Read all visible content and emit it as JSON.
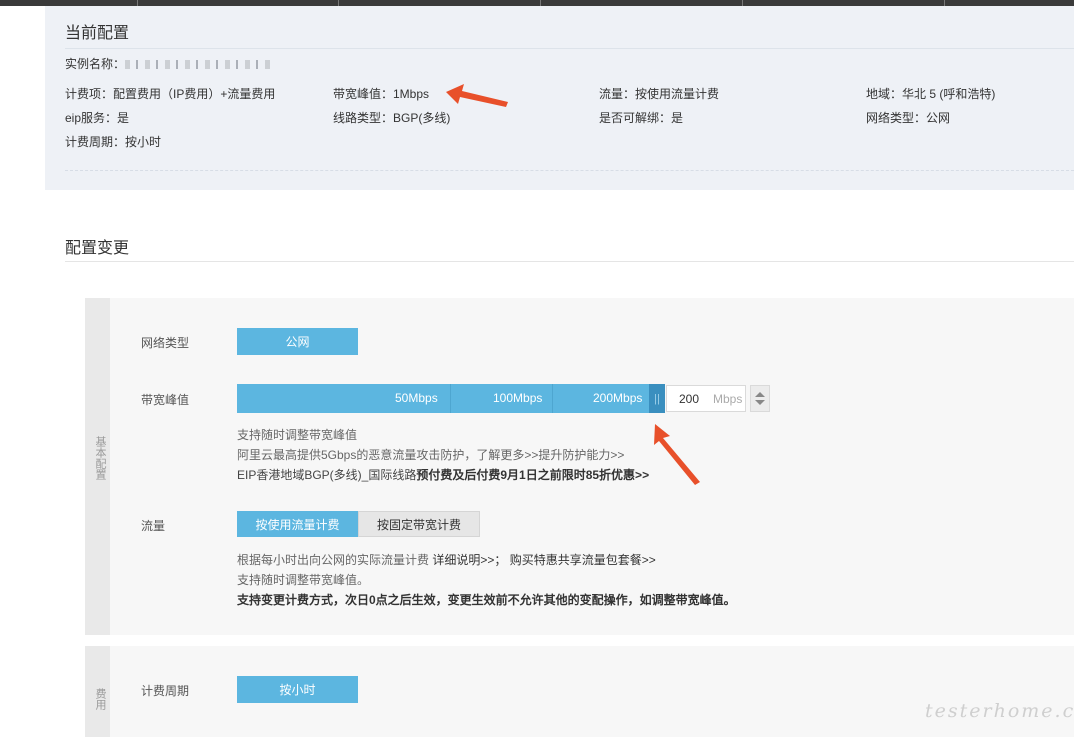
{
  "current_config": {
    "title": "当前配置",
    "instance_label": "实例名称：",
    "billing_item": "计费项：配置费用（IP费用）+流量费用",
    "bandwidth_peak": "带宽峰值：1Mbps",
    "traffic": "流量：按使用流量计费",
    "region": "地域：华北 5 (呼和浩特)",
    "eip_service": "eip服务：是",
    "line_type": "线路类型：BGP(多线)",
    "unbindable": "是否可解绑：是",
    "network_type": "网络类型：公网",
    "billing_cycle": "计费周期：按小时"
  },
  "change": {
    "title": "配置变更"
  },
  "basic_panel": {
    "side_label": "基本配置",
    "network_label": "网络类型",
    "network_value": "公网",
    "bandwidth_label": "带宽峰值",
    "slider_marks": [
      "50Mbps",
      "100Mbps",
      "200Mbps"
    ],
    "slider_value": 200,
    "slider_max": 200,
    "bandwidth_value": "200",
    "bandwidth_unit": "Mbps",
    "note1": "支持随时调整带宽峰值",
    "note2a": "阿里云最高提供5Gbps的恶意流量攻击防护，",
    "note2b": "了解更多>>提升防护能力>>",
    "note3a": "EIP香港地域BGP(多线)_国际线路",
    "note3b": "预付费及后付费9月1日之前限时85折优惠>>",
    "traffic_label": "流量",
    "traffic_btn_usage": "按使用流量计费",
    "traffic_btn_fixed": "按固定带宽计费",
    "traffic_note1a": "根据每小时出向公网的实际流量计费",
    "traffic_note1b": "详细说明>>；  购买特惠共享流量包套餐>>",
    "traffic_note2": "支持随时调整带宽峰值。",
    "traffic_note3": "支持变更计费方式，次日0点之后生效，变更生效前不允许其他的变配操作，如调整带宽峰值。"
  },
  "fee_panel": {
    "side_label": "费用",
    "cycle_label": "计费周期",
    "cycle_value": "按小时"
  },
  "watermark": "testerhome.com",
  "colors": {
    "accent": "#5cb6e0",
    "arrow": "#e8502a"
  }
}
